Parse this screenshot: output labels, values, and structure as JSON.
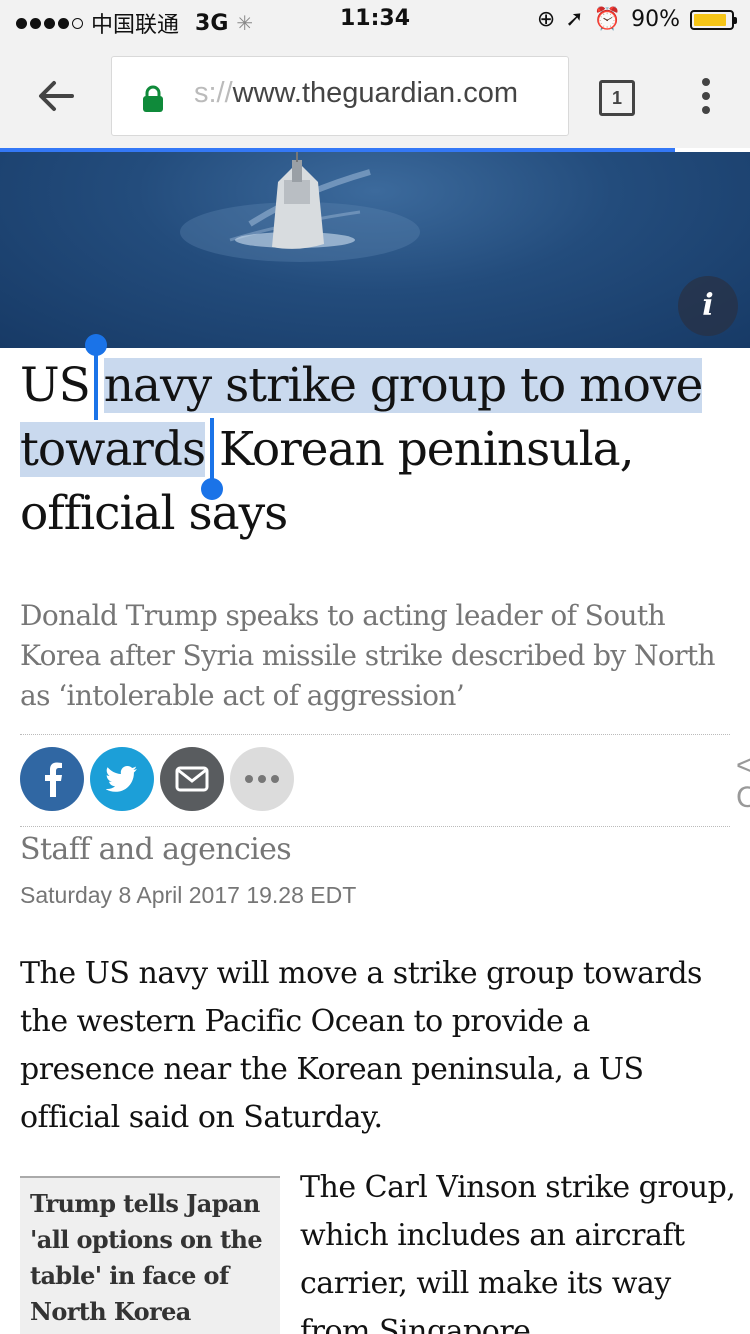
{
  "status_bar": {
    "carrier": "中国联通",
    "network": "3G",
    "time": "11:34",
    "battery_percent": "90%",
    "battery_level": 0.9,
    "battery_color": "#f5c518"
  },
  "browser": {
    "url_prefix": "s://",
    "url_host": "www.theguardian.com",
    "tab_count": "1",
    "progress_fraction": 0.9,
    "progress_color": "#3478f6",
    "lock_color": "#0f8a3a"
  },
  "hero": {
    "info_label": "i"
  },
  "article": {
    "headline_before": "US ",
    "headline_selected": "navy strike group to move towards",
    "headline_after": " Korean peninsula, official says",
    "standfirst": "Donald Trump speaks to acting leader of South Korea after Syria missile strike described by North as ‘intolerable act of aggression’",
    "byline": "Staff and agencies",
    "date": "Saturday 8 April 2017 19.28 EDT",
    "paragraph_1": "The US navy will move a strike group towards the western Pacific Ocean to provide a presence near the Korean peninsula, a US official said on Saturday.",
    "paragraph_2": "The Carl Vinson strike group, which includes an aircraft carrier, will make its way from Singapore",
    "related_link": "Trump tells Japan 'all options on the table' in face of North Korea"
  },
  "share": {
    "icons": [
      "facebook-icon",
      "twitter-icon",
      "email-icon",
      "more-icon"
    ],
    "colors": {
      "facebook": "#3067a3",
      "twitter": "#1c9fd8",
      "email": "#595c5f",
      "more": "#dcdcdc"
    }
  },
  "selection_color": "#c9d9ee"
}
